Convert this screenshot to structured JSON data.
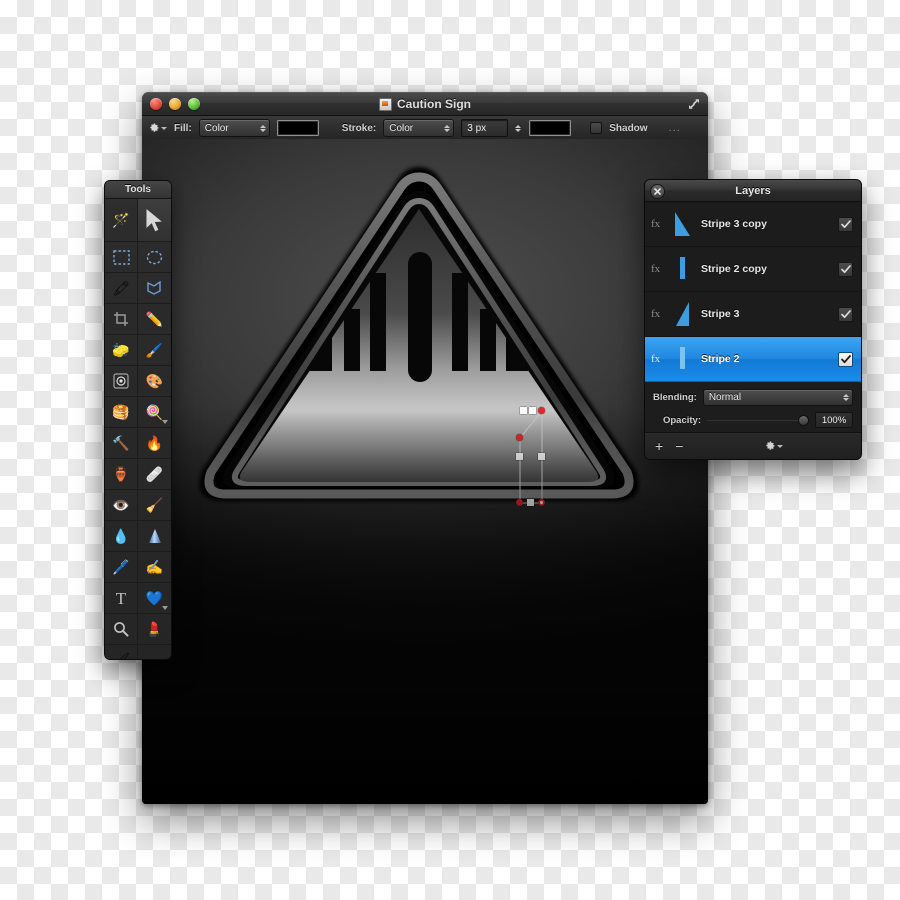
{
  "window": {
    "title": "Caution Sign",
    "title_icon": "document-image-icon",
    "traffic_lights": [
      "close",
      "minimize",
      "maximize"
    ],
    "fullscreen_icon": "fullscreen-arrows-icon"
  },
  "toolbar": {
    "settings_icon": "gear-icon",
    "fill_label": "Fill:",
    "fill_value": "Color",
    "fill_color": "#000000",
    "stroke_label": "Stroke:",
    "stroke_value": "Color",
    "stroke_width": "3 px",
    "stroke_color": "#000000",
    "shadow_label": "Shadow",
    "shadow_checked": false,
    "overflow_label": "..."
  },
  "tools": {
    "title": "Tools",
    "items": [
      {
        "name": "magic-wand-tool",
        "glyph": "🪄",
        "active": false
      },
      {
        "name": "move-selection-tool",
        "glyph": "arrow",
        "active": true
      },
      {
        "name": "rectangular-marquee-tool",
        "glyph": "rect",
        "active": false
      },
      {
        "name": "elliptical-marquee-tool",
        "glyph": "ellipse",
        "active": false
      },
      {
        "name": "smudge-tool",
        "glyph": "🖍",
        "active": false
      },
      {
        "name": "lasso-tool",
        "glyph": "lasso",
        "active": false
      },
      {
        "name": "crop-tool",
        "glyph": "crop",
        "active": false
      },
      {
        "name": "pencil-tool",
        "glyph": "✏️",
        "active": false
      },
      {
        "name": "eraser-tool",
        "glyph": "🧽",
        "active": false
      },
      {
        "name": "paintbrush-tool",
        "glyph": "🖌️",
        "active": false
      },
      {
        "name": "blur-tool",
        "glyph": "◎",
        "active": false
      },
      {
        "name": "paint-can-tool",
        "glyph": "🎨",
        "active": false
      },
      {
        "name": "dodge-tool",
        "glyph": "🥞",
        "active": false
      },
      {
        "name": "hue-tool",
        "glyph": "🍭",
        "active": false
      },
      {
        "name": "burn-tool",
        "glyph": "🔦",
        "active": false
      },
      {
        "name": "flame-tool",
        "glyph": "🔥",
        "active": false
      },
      {
        "name": "clone-stamp-tool",
        "glyph": "🔨",
        "active": false
      },
      {
        "name": "bandage-heal-tool",
        "glyph": "🩹",
        "active": false
      },
      {
        "name": "red-eye-tool",
        "glyph": "👁️",
        "active": false
      },
      {
        "name": "block-eraser-tool",
        "glyph": "🧹",
        "active": false
      },
      {
        "name": "water-drop-tool",
        "glyph": "💧",
        "active": false
      },
      {
        "name": "gradient-cone-tool",
        "glyph": "cone",
        "active": false
      },
      {
        "name": "pen-tool",
        "glyph": "🖊️",
        "active": false
      },
      {
        "name": "freehand-pen-tool",
        "glyph": "✍️",
        "active": false
      },
      {
        "name": "text-tool",
        "glyph": "T",
        "active": false
      },
      {
        "name": "shape-tool",
        "glyph": "💙",
        "active": false
      },
      {
        "name": "zoom-tool",
        "glyph": "🔍",
        "active": false
      },
      {
        "name": "eyedropper-tool",
        "glyph": "💄",
        "active": false
      },
      {
        "name": "retouch-brush-tool",
        "glyph": "🖌",
        "active": false
      }
    ]
  },
  "layers": {
    "title": "Layers",
    "close_icon": "close-icon",
    "items": [
      {
        "name": "Stripe 3 copy",
        "fx": "fx",
        "visible": true,
        "selected": false,
        "thumb": "triangle-right-wide"
      },
      {
        "name": "Stripe 2 copy",
        "fx": "fx",
        "visible": true,
        "selected": false,
        "thumb": "triangle-narrow"
      },
      {
        "name": "Stripe 3",
        "fx": "fx",
        "visible": true,
        "selected": false,
        "thumb": "triangle-left-wide"
      },
      {
        "name": "Stripe 2",
        "fx": "fx",
        "visible": true,
        "selected": true,
        "thumb": "triangle-narrow-light"
      }
    ],
    "blending_label": "Blending:",
    "blending_value": "Normal",
    "opacity_label": "Opacity:",
    "opacity_value": "100%",
    "add_label": "+",
    "remove_label": "−",
    "options_icon": "gear-icon",
    "selected_color": "#1d87e0"
  },
  "canvas": {
    "artwork": "caution-sign-triangle",
    "selection": "bezier-path-stripe-2"
  }
}
